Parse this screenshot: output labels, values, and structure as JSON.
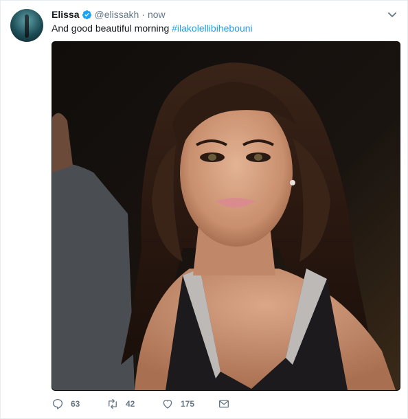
{
  "tweet": {
    "author_name": "Elissa",
    "handle": "@elissakh",
    "separator": "·",
    "time": "now",
    "text": "And good beautiful morning ",
    "hashtag": "#ilakolellibihebouni"
  },
  "icons": {
    "avatar": "avatar",
    "verified": "verified-badge-icon",
    "menu": "chevron-down-icon",
    "reply": "reply-icon",
    "retweet": "retweet-icon",
    "like": "heart-icon",
    "dm": "envelope-icon"
  },
  "actions": {
    "reply_count": "63",
    "retweet_count": "42",
    "like_count": "175"
  },
  "colors": {
    "accent": "#1da1f2",
    "muted": "#657786",
    "text": "#14171a"
  }
}
